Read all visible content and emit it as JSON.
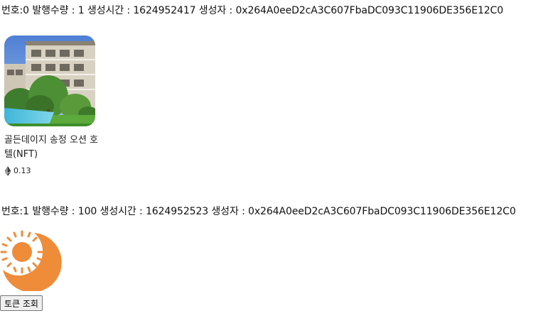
{
  "tokens": [
    {
      "info_line": "번호:0 발행수량 : 1 생성시간 : 1624952417 생성자 : 0x264A0eeD2cA3C607FbaDC093C11906DE356E12C0",
      "nft": {
        "title": "골든데이지 송정 오션 호텔(NFT)",
        "price": "0.13",
        "currency_icon": "ethereum-icon"
      }
    },
    {
      "info_line": "번호:1 발행수량 : 100 생성시간 : 1624952523 생성자 : 0x264A0eeD2cA3C607FbaDC093C11906DE356E12C0",
      "image_icon": "sun-moon-icon",
      "icon_color": "#EE8C3A"
    }
  ],
  "button": {
    "label": "토큰 조회"
  }
}
